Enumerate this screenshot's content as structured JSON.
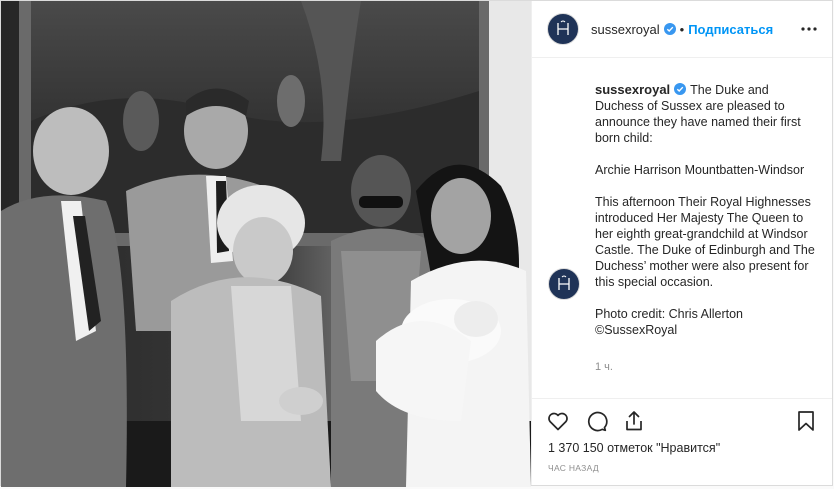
{
  "account": {
    "username": "sussexroyal",
    "verified": true,
    "follow_label": "Подписаться",
    "dot": "•"
  },
  "caption": {
    "username": "sussexroyal",
    "paragraphs": [
      "The Duke and Duchess of Sussex are pleased to announce they have named their first born child:",
      "Archie Harrison Mountbatten-Windsor",
      "This afternoon Their Royal Highnesses introduced Her Majesty The Queen to her eighth great-grandchild at Windsor Castle. The Duke of Edinburgh and The Duchess’ mother were also present for this special occasion.",
      "Photo credit: Chris Allerton ©SussexRoyal"
    ],
    "time": "1 ч."
  },
  "likes": "1 370 150 отметок \"Нравится\"",
  "timestamp": "час назад",
  "icons": {
    "like": "heart-icon",
    "comment": "comment-icon",
    "share": "share-icon",
    "save": "bookmark-icon",
    "more": "more-options-icon"
  },
  "colors": {
    "link": "#0095f6",
    "avatar_bg": "#1f3357",
    "verified": "#3897f0",
    "border": "#efefef",
    "muted": "#8e8e8e"
  }
}
